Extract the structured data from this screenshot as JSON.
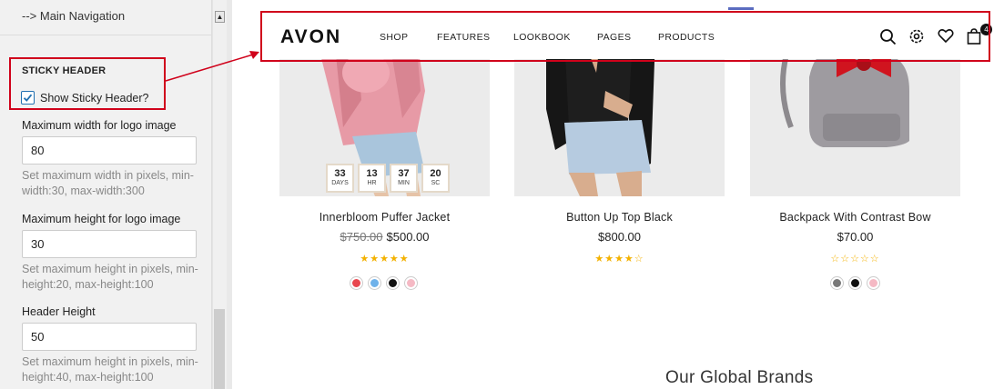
{
  "panel": {
    "nav_link": "--> Main Navigation",
    "section_title": "STICKY HEADER",
    "checkbox_label": "Show Sticky Header?",
    "checkbox_checked": true,
    "fields": [
      {
        "label": "Maximum width for logo image",
        "value": "80",
        "help": "Set maximum width in pixels, min-width:30, max-width:300"
      },
      {
        "label": "Maximum height for logo image",
        "value": "30",
        "help": "Set maximum height in pixels, min-height:20, max-height:100"
      },
      {
        "label": "Header Height",
        "value": "50",
        "help": "Set maximum height in pixels, min-height:40, max-height:100"
      }
    ],
    "scroll_up": "▲"
  },
  "header": {
    "logo": "AVON",
    "menu": [
      "SHOP",
      "FEATURES",
      "LOOKBOOK",
      "PAGES",
      "PRODUCTS"
    ],
    "icons": [
      "search-icon",
      "settings-icon",
      "heart-icon",
      "bag-icon"
    ],
    "cart_count": "4"
  },
  "products": [
    {
      "name": "Innerbloom Puffer Jacket",
      "old_price": "$750.00",
      "price": "$500.00",
      "rating": 5,
      "stars": "★★★★★",
      "swatches": [
        "#e8474f",
        "#6fb2ea",
        "#111111",
        "#f5b9c4"
      ],
      "countdown": [
        {
          "num": "33",
          "unit": "DAYS"
        },
        {
          "num": "13",
          "unit": "HR"
        },
        {
          "num": "37",
          "unit": "MIN"
        },
        {
          "num": "20",
          "unit": "SC"
        }
      ]
    },
    {
      "name": "Button Up Top Black",
      "old_price": "",
      "price": "$800.00",
      "rating": 4,
      "stars": "★★★★☆",
      "swatches": []
    },
    {
      "name": "Backpack With Contrast Bow",
      "old_price": "",
      "price": "$70.00",
      "rating": 0,
      "stars": "☆☆☆☆☆",
      "swatches": [
        "#777777",
        "#111111",
        "#f5b9c4"
      ]
    }
  ],
  "brands_heading": "Our Global Brands",
  "colors": {
    "highlight": "#d0021b",
    "star": "#f3b100",
    "checkbox": "#2271b1"
  }
}
